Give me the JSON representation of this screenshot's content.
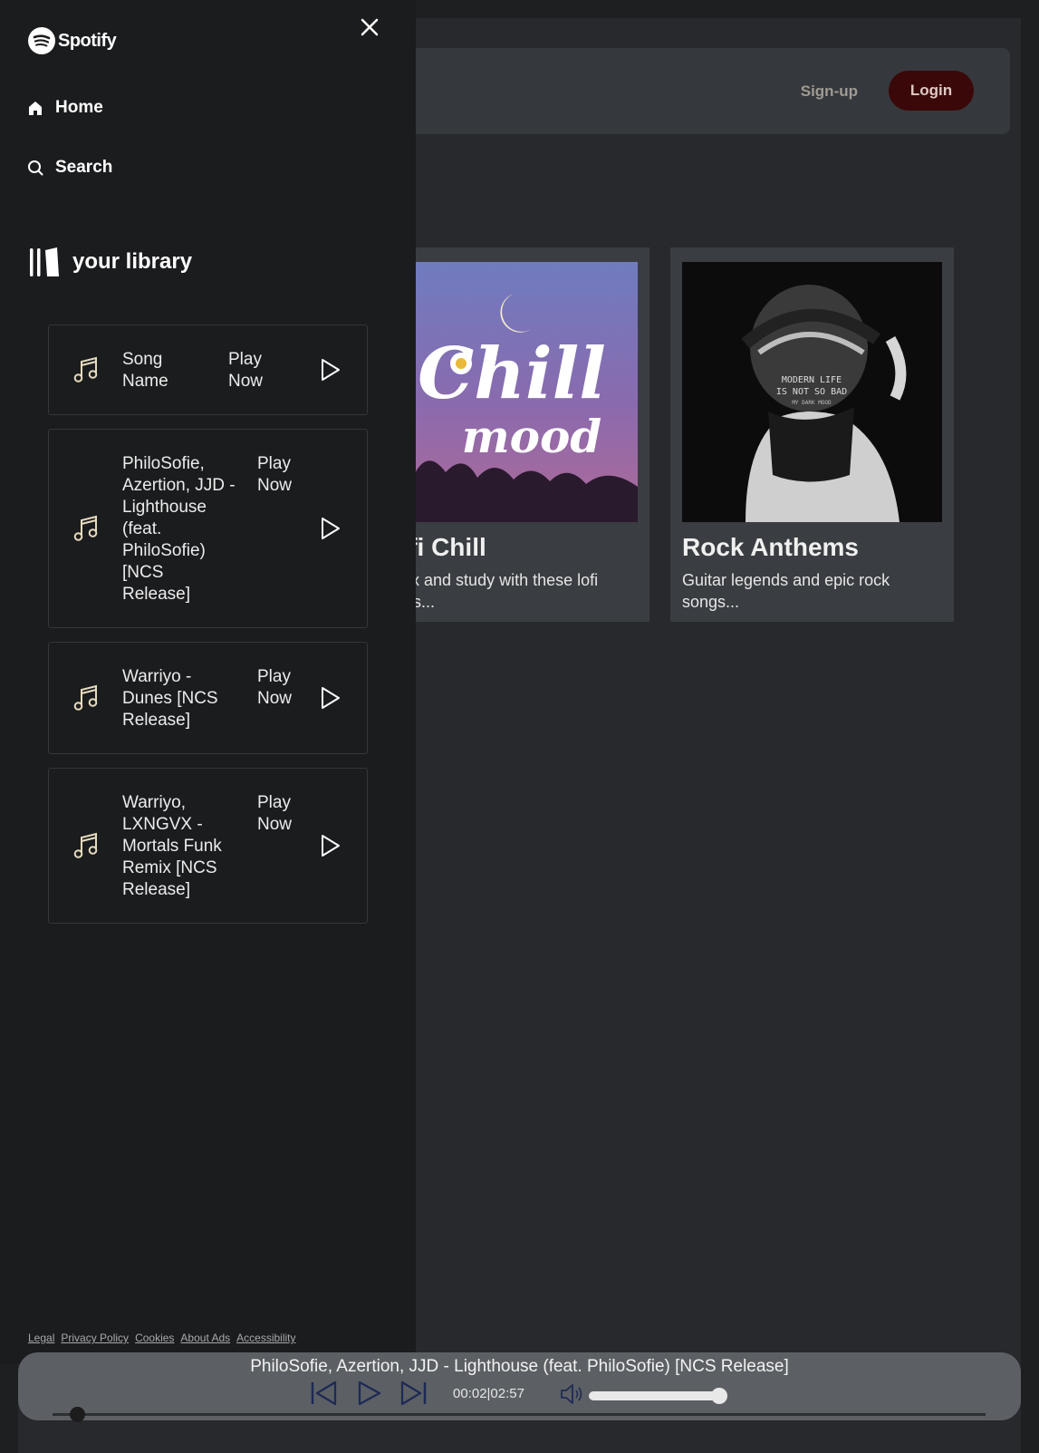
{
  "app": {
    "brand": "Spotify"
  },
  "header": {
    "signup_label": "Sign-up",
    "login_label": "Login"
  },
  "cards": [
    {
      "title": "Lofi Chill",
      "description": "Relax and study with these lofi tracks..."
    },
    {
      "title": "Rock Anthems",
      "description": "Guitar legends and epic rock songs..."
    }
  ],
  "cover_art": {
    "chill_text": "Chill",
    "mood_text": "mood",
    "rock_text": [
      "MODERN LIFE",
      "IS NOT SO BAD",
      "MY DARK MOOD"
    ]
  },
  "sidebar": {
    "nav": [
      {
        "label": "Home"
      },
      {
        "label": "Search"
      }
    ],
    "library_label": "your library",
    "songs": [
      {
        "name": "Song Name",
        "play_label": "Play Now"
      },
      {
        "name": "PhiloSofie, Azertion, JJD - Lighthouse (feat. PhiloSofie) [NCS Release]",
        "play_label": "Play Now"
      },
      {
        "name": "Warriyo - Dunes [NCS Release]",
        "play_label": "Play Now"
      },
      {
        "name": "Warriyo, LXNGVX - Mortals Funk Remix [NCS Release]",
        "play_label": "Play Now"
      }
    ],
    "footer_links": [
      "Legal",
      "Privacy Policy",
      "Cookies",
      "About Ads",
      "Accessibility"
    ]
  },
  "player": {
    "now_playing": "PhiloSofie, Azertion, JJD - Lighthouse (feat. PhiloSofie) [NCS Release]",
    "current_time": "00:02",
    "duration": "02:57",
    "time_display": "00:02|02:57",
    "volume_fraction": 0.95,
    "progress_fraction": 0.011
  },
  "colors": {
    "accent_login_bg": "#3a0808",
    "sidebar_bg": "#1b1c1e",
    "main_bg": "#27292c",
    "player_bg": "#5c6064"
  }
}
